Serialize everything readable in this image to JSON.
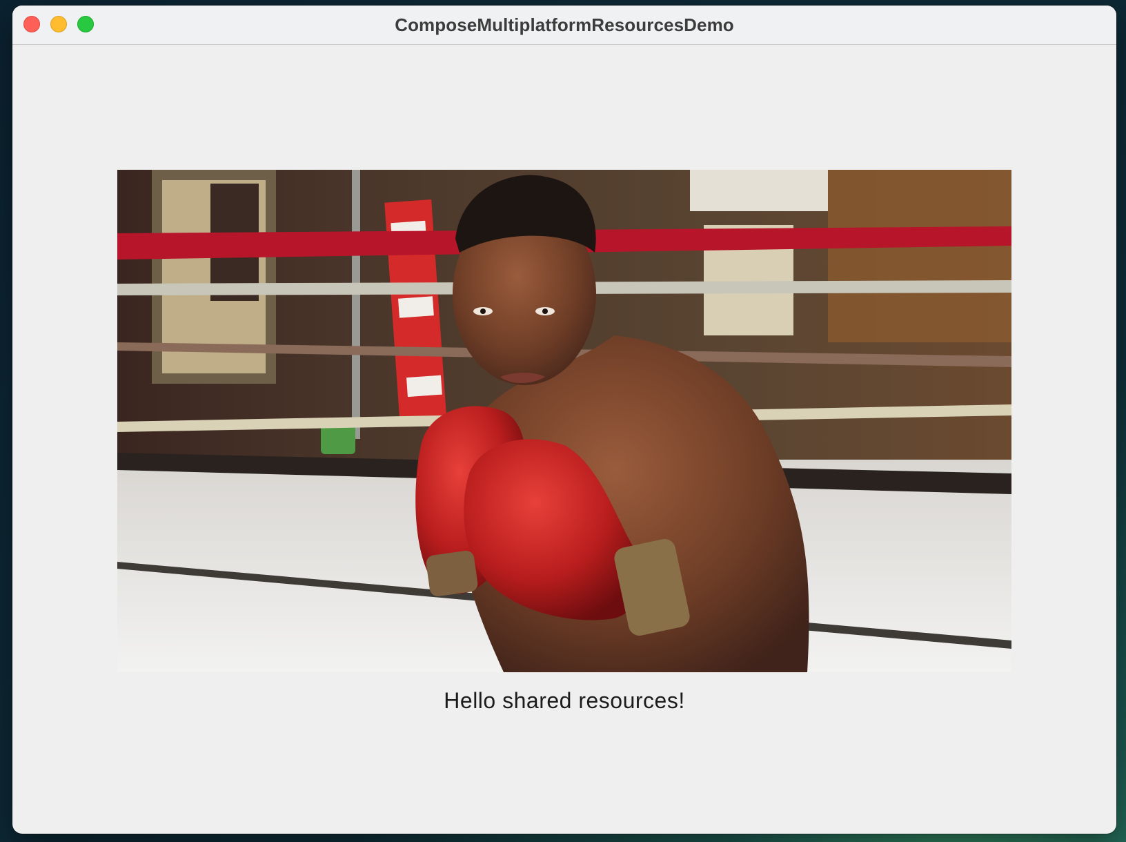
{
  "window": {
    "title": "ComposeMultiplatformResourcesDemo",
    "traffic_lights": [
      "close",
      "minimize",
      "zoom"
    ]
  },
  "main": {
    "image": {
      "alt": "Boxer in red gloves in a boxing ring"
    },
    "greeting": "Hello shared resources!"
  },
  "colors": {
    "close": "#fe5f57",
    "minimize": "#febc2e",
    "zoom": "#28c840",
    "window_bg": "#efefef"
  }
}
